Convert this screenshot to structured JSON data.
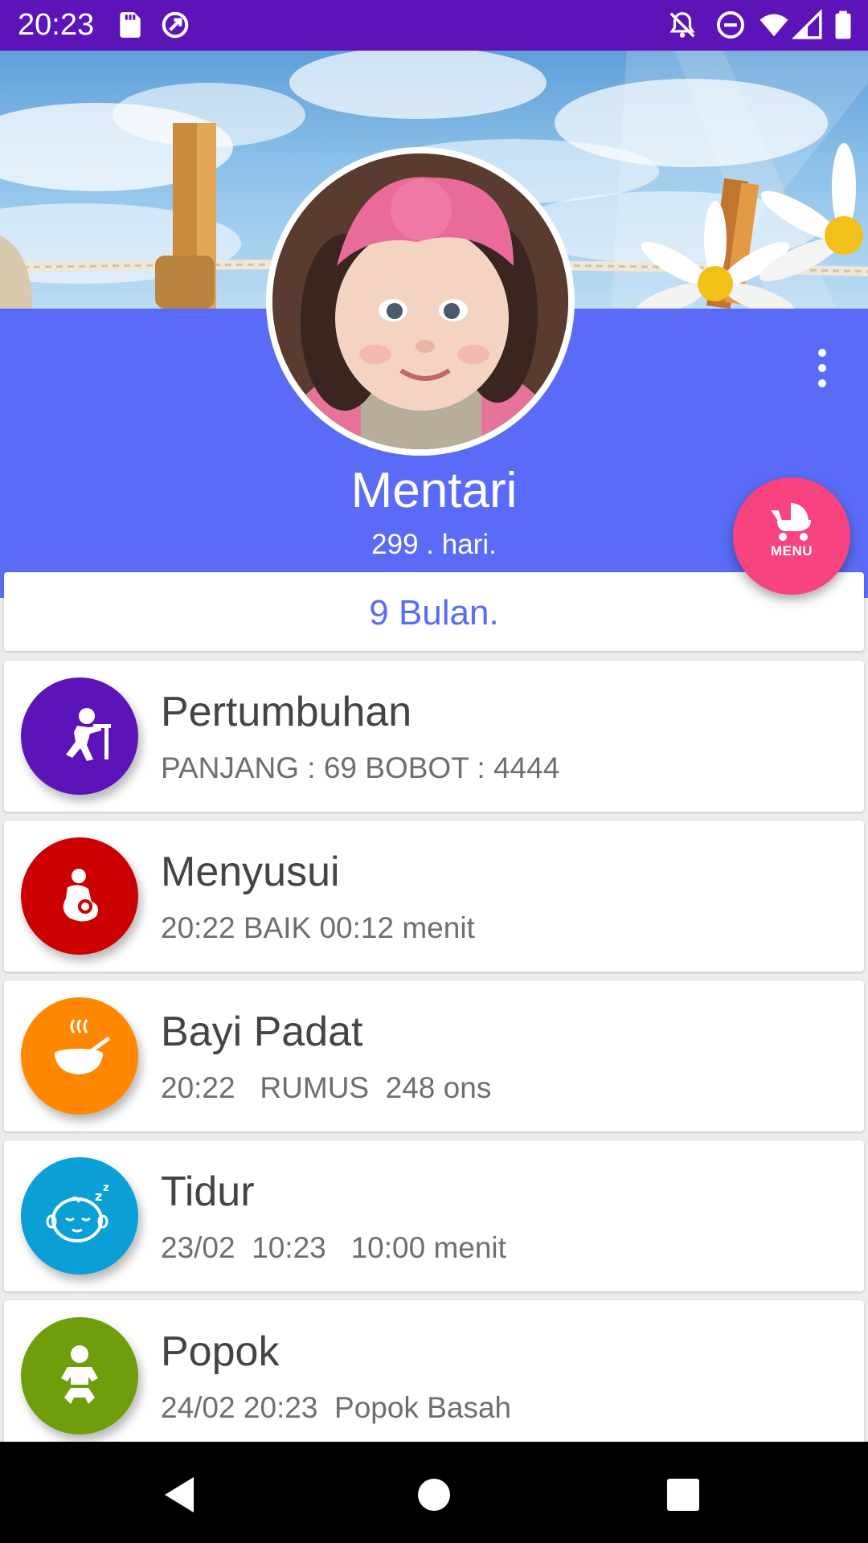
{
  "status_bar": {
    "time": "20:23",
    "left_icons": [
      "sd-card-icon",
      "circle-arrow-icon"
    ],
    "right_icons": [
      "bell-off-icon",
      "do-not-disturb-icon",
      "wifi-icon",
      "signal-icon",
      "battery-icon"
    ],
    "background": "#5c14b8"
  },
  "profile": {
    "name": "Mentari",
    "age_days": "299 . hari.",
    "age_months": "9 Bulan.",
    "band_color": "#5a6cf7"
  },
  "fab": {
    "label": "MENU",
    "icon": "stroller-icon",
    "color": "#f7447f"
  },
  "activities": [
    {
      "title": "Pertumbuhan",
      "detail": "PANJANG : 69 BOBOT : 4444",
      "icon": "growth-child-icon",
      "color": "#5c14b8"
    },
    {
      "title": "Menyusui",
      "detail": "20:22 BAIK 00:12 menit",
      "icon": "breastfeeding-icon",
      "color": "#cc0000"
    },
    {
      "title": "Bayi Padat",
      "detail": "20:22   RUMUS  248 ons",
      "icon": "food-bowl-icon",
      "color": "#ff8800"
    },
    {
      "title": "Tidur",
      "detail": "23/02  10:23   10:00 menit",
      "icon": "sleeping-baby-icon",
      "color": "#0aa0d6"
    },
    {
      "title": "Popok",
      "detail": "24/02 20:23  Popok Basah",
      "icon": "diaper-baby-icon",
      "color": "#6e9e0c"
    }
  ],
  "nav": {
    "icons": [
      "back-icon",
      "home-icon",
      "recents-icon"
    ]
  }
}
